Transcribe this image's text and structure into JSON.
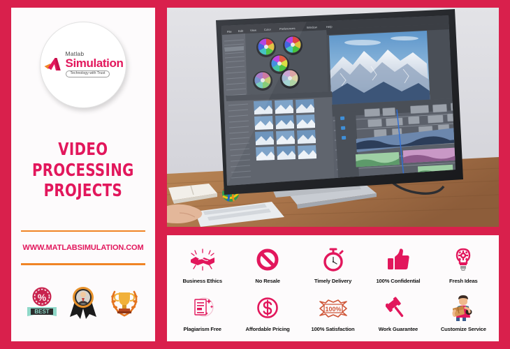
{
  "theme": {
    "border_color": "#d9204c",
    "panel_bg": "#fdfbfc",
    "accent_pink": "#e2175c",
    "accent_orange": "#f08425",
    "label_color": "#111111"
  },
  "left_panel": {
    "logo": {
      "brand_small": "Matlab",
      "brand_large": "Simulation",
      "tagline": "Technology with Trust",
      "mark": "matlab-logo-mark"
    },
    "title_lines": [
      "VIDEO",
      "PROCESSING",
      "PROJECTS"
    ],
    "website": "WWW.MATLABSIMULATION.COM",
    "badges": [
      {
        "name": "best-percent-badge",
        "label": "BEST"
      },
      {
        "name": "expert-award-ribbon-badge",
        "label": ""
      },
      {
        "name": "trophy-laurel-badge",
        "label": ""
      }
    ]
  },
  "monitor": {
    "name": "video-editing-workstation-photo",
    "menubar": [
      "File",
      "Edit",
      "View",
      "Color",
      "Preferences",
      "Window",
      "Help"
    ],
    "panels": {
      "color_grading": "Color Editing",
      "media_browser": "File Browser",
      "preview": "Video Preview",
      "timeline": "Timeline"
    },
    "preview_subject": "snow-covered-mountain-range",
    "color_wheels": 5,
    "timeline_tracks": 6,
    "desk_items": [
      "open-book",
      "colorful-ball",
      "laptop",
      "keyboard",
      "hand"
    ]
  },
  "features": {
    "row1": [
      {
        "label": "Business Ethics",
        "icon": "handshake-icon"
      },
      {
        "label": "No Resale",
        "icon": "prohibition-icon"
      },
      {
        "label": "Timely Delivery",
        "icon": "stopwatch-icon"
      },
      {
        "label": "100% Confidential",
        "icon": "thumbs-up-icon"
      },
      {
        "label": "Fresh Ideas",
        "icon": "lightbulb-gear-icon"
      }
    ],
    "row2": [
      {
        "label": "Plagiarism Free",
        "icon": "document-sparkle-icon"
      },
      {
        "label": "Affordable Pricing",
        "icon": "dollar-circle-icon"
      },
      {
        "label": "100% Satisfaction",
        "icon": "hundred-percent-seal-icon"
      },
      {
        "label": "Work Guarantee",
        "icon": "gavel-icon"
      },
      {
        "label": "Customize Service",
        "icon": "delivery-person-icon"
      }
    ]
  }
}
